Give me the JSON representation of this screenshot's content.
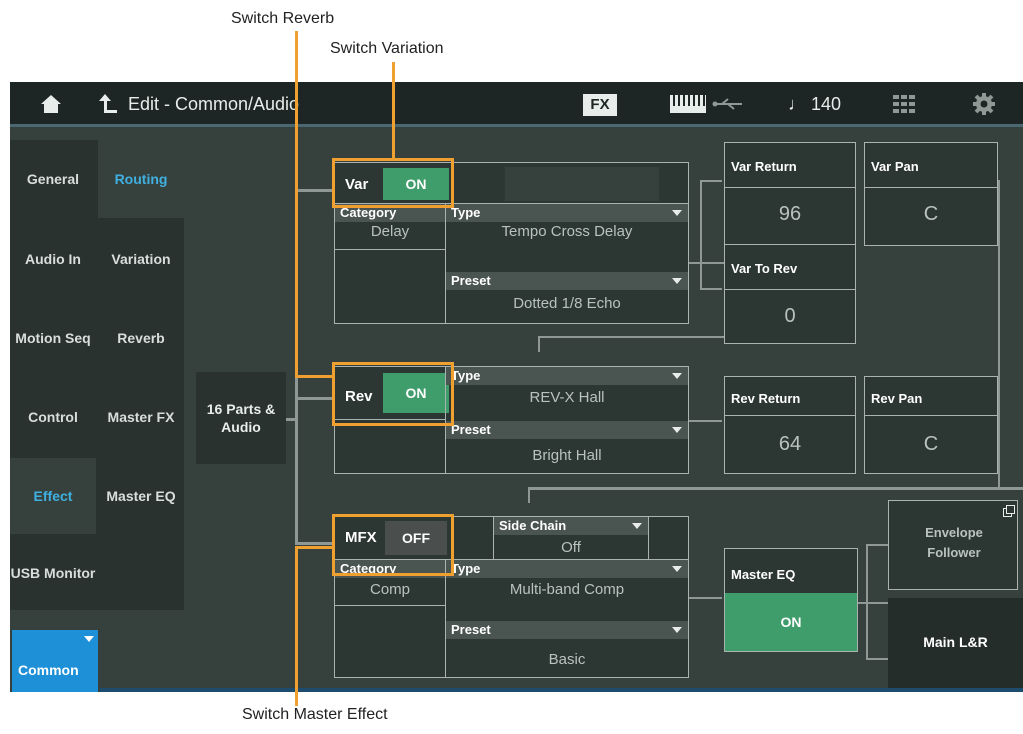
{
  "callouts": {
    "switch_reverb": "Switch Reverb",
    "switch_variation": "Switch Variation",
    "switch_master_effect": "Switch Master Effect"
  },
  "topbar": {
    "title": "Edit - Common/Audio",
    "fx_label": "FX",
    "tempo": "♩ 140",
    "icons": [
      "home-icon",
      "back-icon",
      "fx-icon",
      "keyboard-icon",
      "usb-icon",
      "grid-icon",
      "gear-icon"
    ]
  },
  "left_tabs": [
    "General",
    "Audio In",
    "Motion Seq",
    "Control",
    "Effect",
    "USB Monitor"
  ],
  "sub_tabs": [
    "Routing",
    "Variation",
    "Reverb",
    "Master FX",
    "Master EQ"
  ],
  "common_button": "Common",
  "source": "16 Parts & Audio",
  "variation": {
    "label": "Var",
    "switch": "ON",
    "category_label": "Category",
    "category": "Delay",
    "type_label": "Type",
    "type": "Tempo Cross Delay",
    "preset_label": "Preset",
    "preset": "Dotted 1/8 Echo"
  },
  "reverb": {
    "label": "Rev",
    "switch": "ON",
    "type_label": "Type",
    "type": "REV-X Hall",
    "preset_label": "Preset",
    "preset": "Bright Hall"
  },
  "mfx": {
    "label": "MFX",
    "switch": "OFF",
    "sidechain_label": "Side Chain",
    "sidechain": "Off",
    "category_label": "Category",
    "category": "Comp",
    "type_label": "Type",
    "type": "Multi-band Comp",
    "preset_label": "Preset",
    "preset": "Basic"
  },
  "params": {
    "var_return_label": "Var Return",
    "var_return": "96",
    "var_pan_label": "Var Pan",
    "var_pan": "C",
    "var_to_rev_label": "Var To Rev",
    "var_to_rev": "0",
    "rev_return_label": "Rev Return",
    "rev_return": "64",
    "rev_pan_label": "Rev Pan",
    "rev_pan": "C"
  },
  "master_eq": {
    "label": "Master EQ",
    "switch": "ON"
  },
  "envelope_follower": "Envelope Follower",
  "main_lr": "Main L&R",
  "colors": {
    "accent_green": "#3f9c6b",
    "highlight": "#f0a030",
    "tab_blue": "#3fb0e0",
    "common_blue": "#1e90d8"
  }
}
